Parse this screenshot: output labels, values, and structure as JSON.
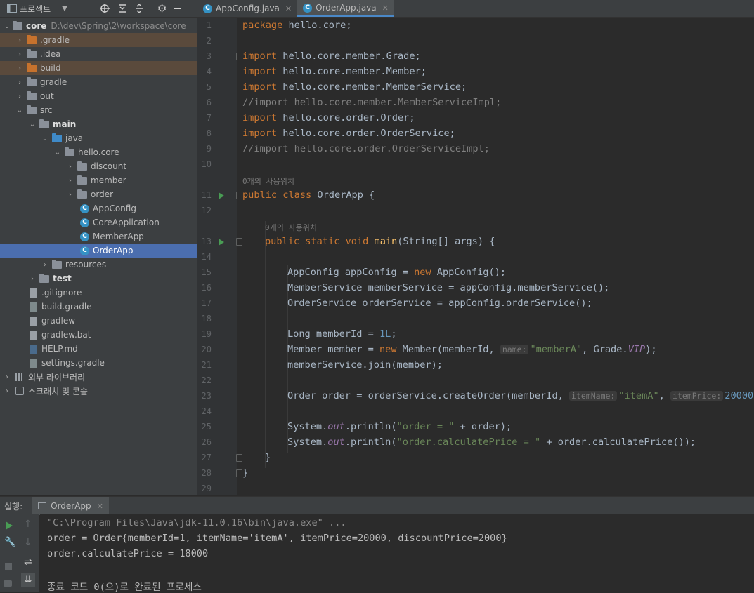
{
  "project": {
    "header_label": "프로젝트",
    "items": [
      {
        "label": "core",
        "path": "D:\\dev\\Spring\\2\\workspace\\core"
      },
      {
        "label": ".gradle"
      },
      {
        "label": ".idea"
      },
      {
        "label": "build"
      },
      {
        "label": "gradle"
      },
      {
        "label": "out"
      },
      {
        "label": "src"
      },
      {
        "label": "main"
      },
      {
        "label": "java"
      },
      {
        "label": "hello.core"
      },
      {
        "label": "discount"
      },
      {
        "label": "member"
      },
      {
        "label": "order"
      },
      {
        "label": "AppConfig"
      },
      {
        "label": "CoreApplication"
      },
      {
        "label": "MemberApp"
      },
      {
        "label": "OrderApp"
      },
      {
        "label": "resources"
      },
      {
        "label": "test"
      },
      {
        "label": ".gitignore"
      },
      {
        "label": "build.gradle"
      },
      {
        "label": "gradlew"
      },
      {
        "label": "gradlew.bat"
      },
      {
        "label": "HELP.md"
      },
      {
        "label": "settings.gradle"
      },
      {
        "label": "외부 라이브러리"
      },
      {
        "label": "스크래치 및 콘솔"
      }
    ]
  },
  "tabs": [
    {
      "label": "AppConfig.java"
    },
    {
      "label": "OrderApp.java"
    }
  ],
  "editor": {
    "line_numbers": [
      "1",
      "2",
      "3",
      "4",
      "5",
      "6",
      "7",
      "8",
      "9",
      "10",
      "11",
      "12",
      "13",
      "14",
      "15",
      "16",
      "17",
      "18",
      "19",
      "20",
      "21",
      "22",
      "23",
      "24",
      "25",
      "26",
      "27",
      "28",
      "29"
    ],
    "usage_hint": "0개의 사용위치",
    "usage_hint2": "0개의 사용위치",
    "t": {
      "package": "package",
      "pkg_name": " hello.core;",
      "import": "import",
      "imp1": " hello.core.member.Grade;",
      "imp2": " hello.core.member.Member;",
      "imp3": " hello.core.member.MemberService;",
      "cmt1": "//import hello.core.member.MemberServiceImpl;",
      "imp4": " hello.core.order.Order;",
      "imp5": " hello.core.order.OrderService;",
      "cmt2": "//import hello.core.order.OrderServiceImpl;",
      "public": "public",
      "class": " class",
      "cls_name": " OrderApp {",
      "static": " static",
      "void": " void",
      "main": " main",
      "main_args": "(String[] args) {",
      "l15a": "AppConfig appConfig = ",
      "new": "new",
      "l15b": " AppConfig();",
      "l16": "MemberService memberService = appConfig.memberService();",
      "l17": "OrderService orderService = appConfig.orderService();",
      "l19a": "Long memberId = ",
      "l19num": "1L",
      "l19b": ";",
      "l20a": "Member member = ",
      "l20b": " Member(memberId, ",
      "l20hint": "name:",
      "l20str": "\"memberA\"",
      "l20c": ", Grade.",
      "l20vip": "VIP",
      "l20d": ");",
      "l21": "memberService.join(member);",
      "l23a": "Order order = orderService.createOrder(memberId, ",
      "l23hint1": "itemName:",
      "l23str": "\"itemA\"",
      "l23b": ", ",
      "l23hint2": "itemPrice:",
      "l23num": "20000",
      "l23c": ");",
      "sys": "System.",
      "out": "out",
      "println": ".println(",
      "l25str": "\"order = \"",
      "l25b": " + order);",
      "l26str": "\"order.calculatePrice = \"",
      "l26b": " + order.calculatePrice());",
      "brace": "}"
    }
  },
  "run": {
    "label": "실행:",
    "tab": "OrderApp",
    "console": [
      "\"C:\\Program Files\\Java\\jdk-11.0.16\\bin\\java.exe\" ...",
      "order = Order{memberId=1, itemName='itemA', itemPrice=20000, discountPrice=2000}",
      "order.calculatePrice = 18000",
      "",
      "종료 코드 0(으)로 완료된 프로세스"
    ]
  }
}
